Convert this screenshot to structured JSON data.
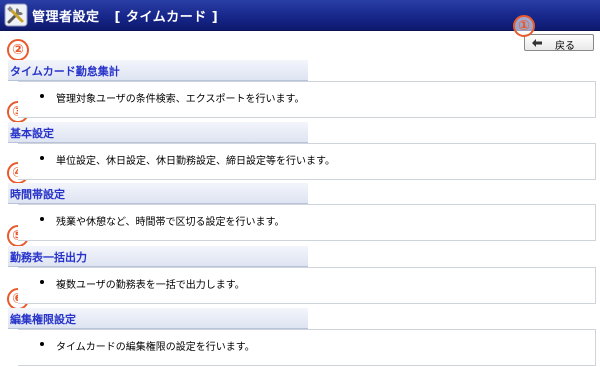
{
  "header": {
    "title": "管理者設定",
    "subtitle": "[ タイムカード ]",
    "icon": "tools-icon"
  },
  "toolbar": {
    "back_label": "戻る",
    "back_icon": "back-arrow-icon"
  },
  "annotations": [
    "①",
    "②",
    "③",
    "④",
    "⑤",
    "⑥"
  ],
  "sections": [
    {
      "title": "タイムカード勤怠集計",
      "description": "管理対象ユーザの条件検索、エクスポートを行います。"
    },
    {
      "title": "基本設定",
      "description": "単位設定、休日設定、休日勤務設定、締日設定等を行います。"
    },
    {
      "title": "時間帯設定",
      "description": "残業や休憩など、時間帯で区切る設定を行います。"
    },
    {
      "title": "勤務表一括出力",
      "description": "複数ユーザの勤務表を一括で出力します。"
    },
    {
      "title": "編集権限設定",
      "description": "タイムカードの編集権限の設定を行います。"
    }
  ],
  "colors": {
    "header_bg": "#17268a",
    "link": "#2733c9",
    "annotation": "#e85a2b"
  }
}
